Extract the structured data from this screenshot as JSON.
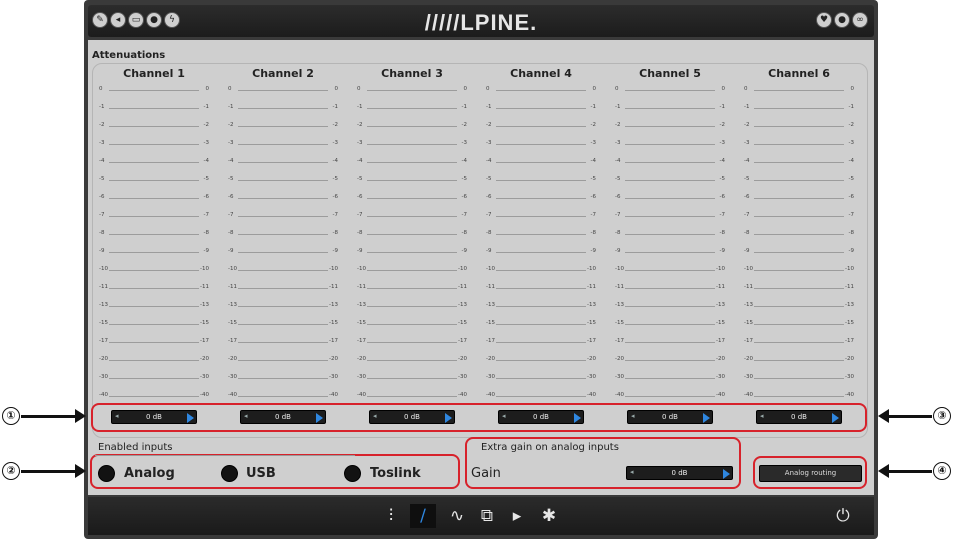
{
  "header": {
    "logo": "/////LPINE.",
    "left_icons": [
      "pencil-icon",
      "back-icon",
      "battery-icon",
      "bulb-icon",
      "lightning-icon"
    ],
    "right_icons": [
      "heart-icon",
      "bulb-icon",
      "link-icon"
    ]
  },
  "attenuations": {
    "title": "Attenuations",
    "tick_labels": [
      "0",
      "-1",
      "-2",
      "-3",
      "-4",
      "-5",
      "-6",
      "-7",
      "-8",
      "-9",
      "-10",
      "-11",
      "-13",
      "-15",
      "-17",
      "-20",
      "-30",
      "-40"
    ],
    "channels": [
      {
        "label": "Channel 1",
        "value": "0 dB"
      },
      {
        "label": "Channel 2",
        "value": "0 dB"
      },
      {
        "label": "Channel 3",
        "value": "0 dB"
      },
      {
        "label": "Channel 4",
        "value": "0 dB"
      },
      {
        "label": "Channel 5",
        "value": "0 dB"
      },
      {
        "label": "Channel 6",
        "value": "0 dB"
      }
    ]
  },
  "enabled_inputs": {
    "title": "Enabled inputs",
    "options": [
      "Analog",
      "USB",
      "Toslink"
    ]
  },
  "extra_gain": {
    "title": "Extra gain on analog inputs",
    "gain_label": "Gain",
    "value": "0 dB"
  },
  "routing": {
    "label": "Analog routing"
  },
  "callouts": [
    "①",
    "②",
    "③",
    "④"
  ],
  "bottom_toolbar": {
    "icons": [
      "equalizer-icon",
      "cable-icon",
      "waveform-icon",
      "copy-icon",
      "speaker-icon",
      "gear-icon"
    ],
    "power_icon": "power-icon"
  },
  "colors": {
    "accent": "#2f87e0",
    "callout_red": "#d7222b"
  }
}
